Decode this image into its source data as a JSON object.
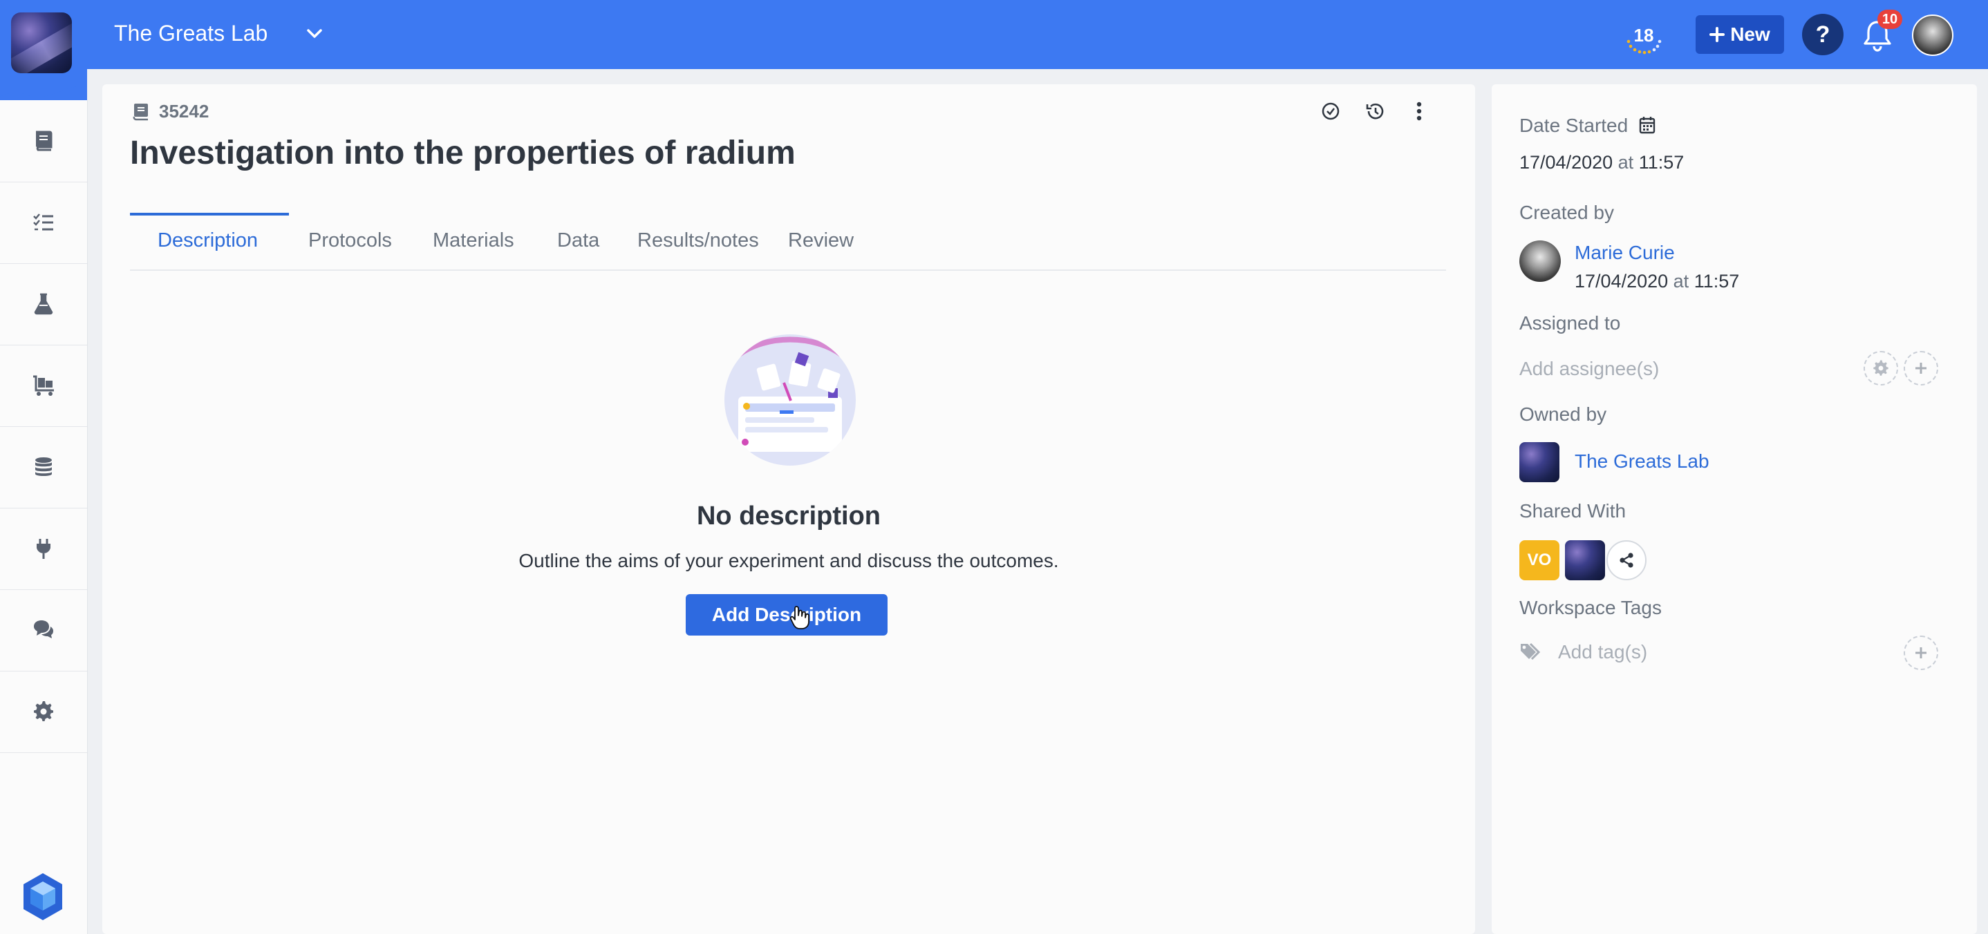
{
  "header": {
    "workspace_name": "The Greats Lab",
    "counter": "18",
    "new_label": "New",
    "help_label": "?",
    "notifications_count": "10"
  },
  "sidebar": {
    "items": [
      {
        "icon": "book-icon"
      },
      {
        "icon": "checklist-icon"
      },
      {
        "icon": "flask-icon"
      },
      {
        "icon": "trolley-icon"
      },
      {
        "icon": "database-icon"
      },
      {
        "icon": "plug-icon"
      },
      {
        "icon": "chat-icon"
      },
      {
        "icon": "gear-icon"
      }
    ]
  },
  "experiment": {
    "id": "35242",
    "title": "Investigation into the properties of radium",
    "tabs": [
      "Description",
      "Protocols",
      "Materials",
      "Data",
      "Results/notes",
      "Review"
    ],
    "active_tab": "Description",
    "empty_title": "No description",
    "empty_text": "Outline the aims of your experiment and discuss the outcomes.",
    "add_button": "Add Description"
  },
  "details": {
    "date_started_label": "Date Started",
    "date_started_date": "17/04/2020",
    "at": "at",
    "date_started_time": "11:57",
    "created_by_label": "Created by",
    "creator_name": "Marie Curie",
    "created_date": "17/04/2020",
    "created_time": "11:57",
    "assigned_label": "Assigned to",
    "assignee_placeholder": "Add assignee(s)",
    "owned_label": "Owned by",
    "owner_name": "The Greats Lab",
    "shared_label": "Shared With",
    "shared_initials": "VO",
    "tags_label": "Workspace Tags",
    "tags_placeholder": "Add tag(s)"
  },
  "colors": {
    "header_blue": "#3d79f2",
    "accent_blue": "#2c6bd8",
    "button_blue": "#2e6ae0",
    "badge_red": "#e8403a",
    "avatar_yellow": "#f5b71d"
  }
}
